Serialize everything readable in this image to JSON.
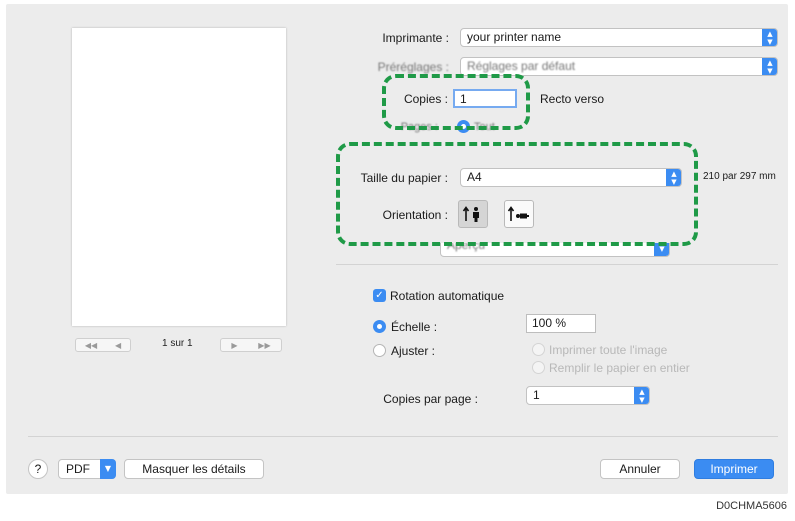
{
  "preview": {
    "page_count": "1 sur 1",
    "nav_first": "◀◀",
    "nav_prev": "◀",
    "nav_next": "▶",
    "nav_last": "▶▶"
  },
  "printer": {
    "label": "Imprimante :",
    "value": "your printer name"
  },
  "presets": {
    "label": "Préréglages :",
    "value": "Réglages par défaut"
  },
  "copies": {
    "label": "Copies :",
    "value": "1",
    "duplex_label": "Recto verso"
  },
  "pages": {
    "label": "Pages :",
    "option": "Tout"
  },
  "paper_size": {
    "label": "Taille du papier :",
    "value": "A4",
    "dimensions": "210 par 297 mm"
  },
  "orientation": {
    "label": "Orientation :",
    "portrait_icon": "portrait-orientation-icon",
    "landscape_icon": "landscape-orientation-icon"
  },
  "section_popup": {
    "value": "Aperçu"
  },
  "auto_rotate": {
    "label": "Rotation automatique",
    "checked": true
  },
  "scale": {
    "label": "Échelle :",
    "value": "100 %"
  },
  "fit": {
    "label": "Ajuster :",
    "option_print_entire": "Imprimer toute l'image",
    "option_fill_paper": "Remplir le papier en entier"
  },
  "copies_per_page": {
    "label": "Copies par page :",
    "value": "1"
  },
  "footer": {
    "help": "?",
    "pdf": "PDF",
    "hide_details": "Masquer les détails",
    "cancel": "Annuler",
    "print": "Imprimer"
  },
  "caption": "D0CHMA5606",
  "colors": {
    "accent": "#3b8cf2",
    "highlight": "#1f9a47",
    "dialog_bg": "#ececec"
  }
}
